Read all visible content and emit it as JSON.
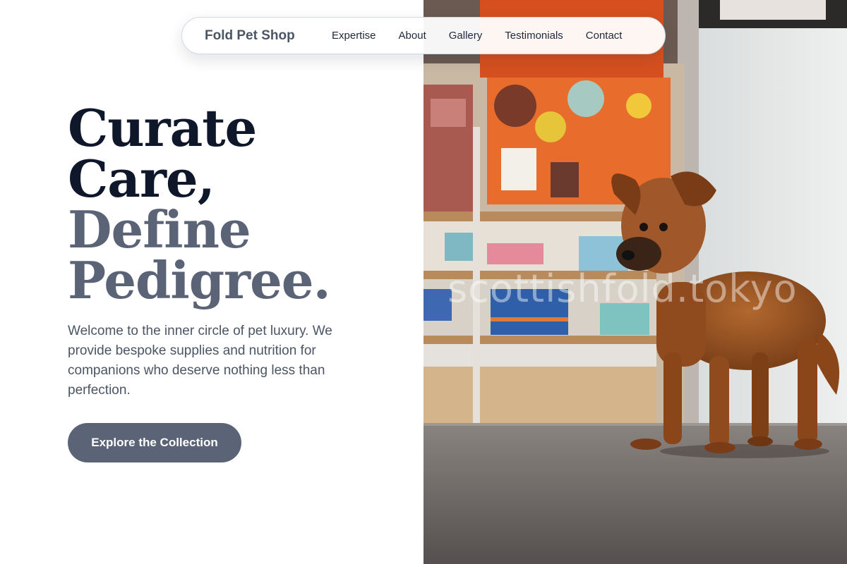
{
  "nav": {
    "brand": "Fold Pet Shop",
    "links": [
      "Expertise",
      "About",
      "Gallery",
      "Testimonials",
      "Contact"
    ]
  },
  "hero": {
    "headline_lines": [
      "Curate",
      "Care,",
      "Define",
      "Pedigree."
    ],
    "intro": "Welcome to the inner circle of pet luxury. We provide bespoke supplies and nutrition for companions who deserve nothing less than perfection.",
    "cta_label": "Explore the Collection"
  },
  "photo": {
    "watermark": "scottishfold.tokyo"
  },
  "colors": {
    "headline_dark": "#0f172a",
    "headline_muted": "#5b6377",
    "button_bg": "#5b6377",
    "body_text": "#4b5563"
  }
}
